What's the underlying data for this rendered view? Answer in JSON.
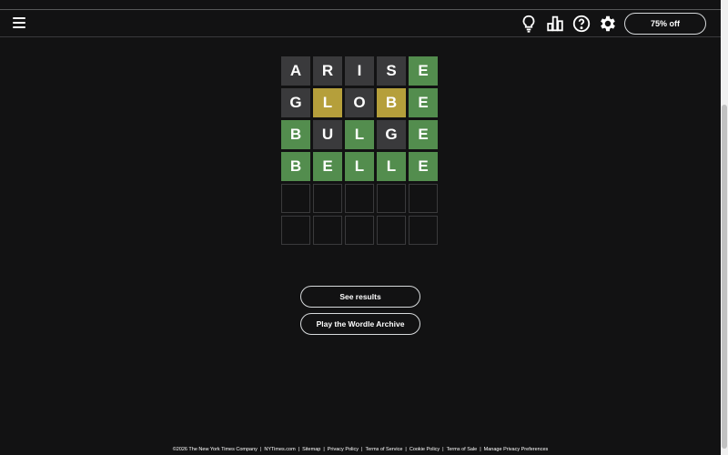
{
  "header": {
    "menu_icon": "hamburger-menu-icon",
    "hint_icon": "lightbulb-icon",
    "stats_icon": "bar-chart-icon",
    "help_icon": "question-circle-icon",
    "settings_icon": "gear-icon",
    "subscribe_label": "75% off"
  },
  "board": {
    "rows": [
      [
        {
          "letter": "A",
          "state": "absent"
        },
        {
          "letter": "R",
          "state": "absent"
        },
        {
          "letter": "I",
          "state": "absent"
        },
        {
          "letter": "S",
          "state": "absent"
        },
        {
          "letter": "E",
          "state": "correct"
        }
      ],
      [
        {
          "letter": "G",
          "state": "absent"
        },
        {
          "letter": "L",
          "state": "present"
        },
        {
          "letter": "O",
          "state": "absent"
        },
        {
          "letter": "B",
          "state": "present"
        },
        {
          "letter": "E",
          "state": "correct"
        }
      ],
      [
        {
          "letter": "B",
          "state": "correct"
        },
        {
          "letter": "U",
          "state": "absent"
        },
        {
          "letter": "L",
          "state": "correct"
        },
        {
          "letter": "G",
          "state": "absent"
        },
        {
          "letter": "E",
          "state": "correct"
        }
      ],
      [
        {
          "letter": "B",
          "state": "correct"
        },
        {
          "letter": "E",
          "state": "correct"
        },
        {
          "letter": "L",
          "state": "correct"
        },
        {
          "letter": "L",
          "state": "correct"
        },
        {
          "letter": "E",
          "state": "correct"
        }
      ],
      [
        {
          "letter": "",
          "state": "empty"
        },
        {
          "letter": "",
          "state": "empty"
        },
        {
          "letter": "",
          "state": "empty"
        },
        {
          "letter": "",
          "state": "empty"
        },
        {
          "letter": "",
          "state": "empty"
        }
      ],
      [
        {
          "letter": "",
          "state": "empty"
        },
        {
          "letter": "",
          "state": "empty"
        },
        {
          "letter": "",
          "state": "empty"
        },
        {
          "letter": "",
          "state": "empty"
        },
        {
          "letter": "",
          "state": "empty"
        }
      ]
    ]
  },
  "actions": {
    "see_results_label": "See results",
    "archive_label": "Play the Wordle Archive"
  },
  "footer": {
    "links": [
      "©2026 The New York Times Company",
      "NYTimes.com",
      "Sitemap",
      "Privacy Policy",
      "Terms of Service",
      "Cookie Policy",
      "Terms of Sale",
      "Manage Privacy Preferences"
    ]
  },
  "colors": {
    "background": "#121213",
    "absent": "#3a3a3c",
    "present": "#b59f3b",
    "correct": "#538d4e"
  }
}
